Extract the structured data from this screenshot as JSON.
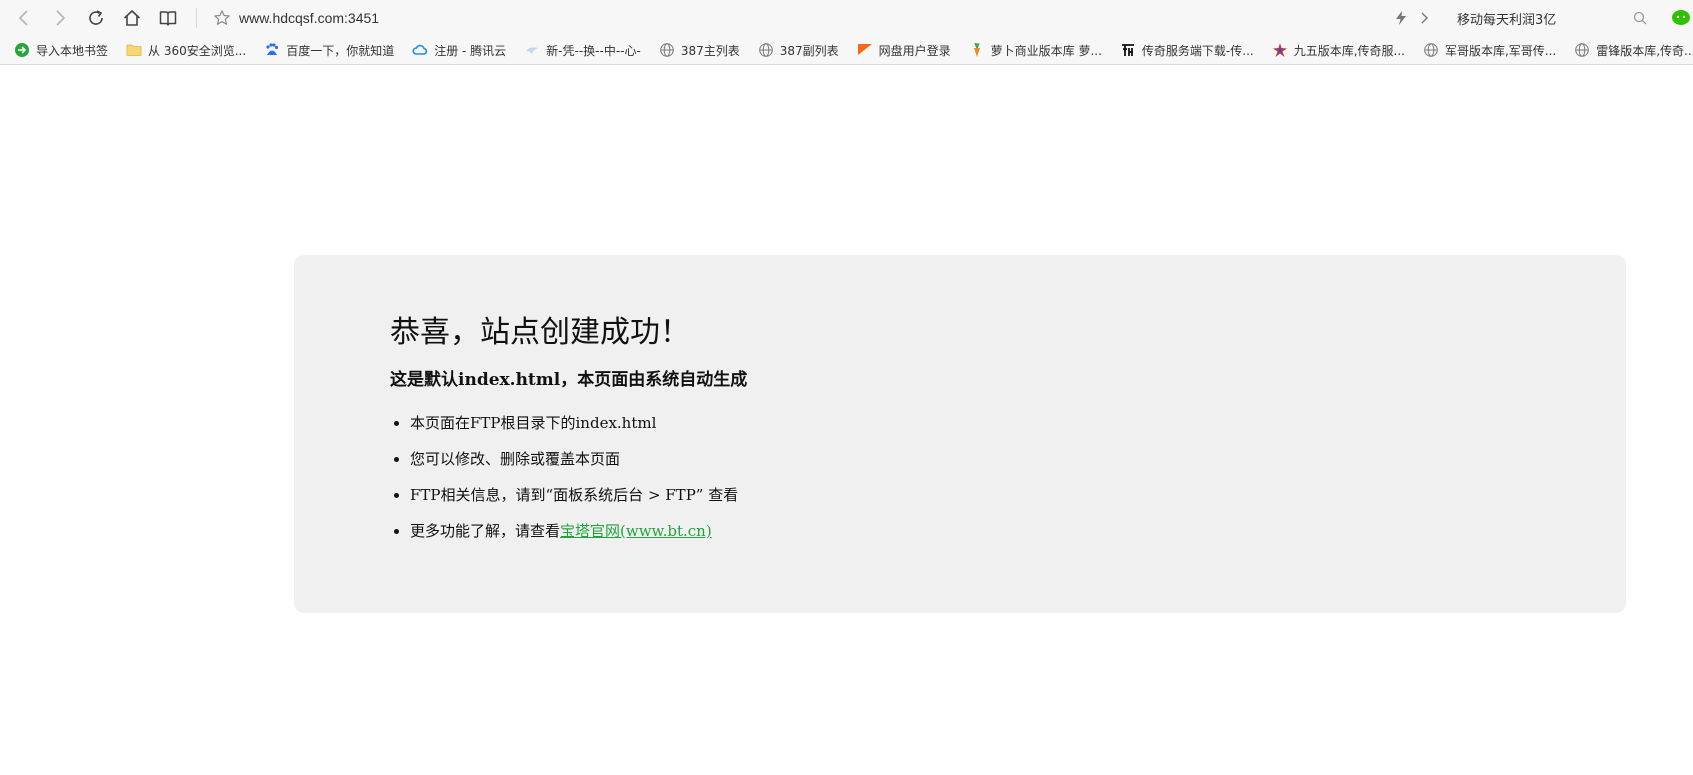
{
  "browser": {
    "url": "www.hdcqsf.com:3451",
    "search_text": "移动每天利润3亿",
    "bookmarks": [
      {
        "label": "导入本地书签",
        "icon": "import-icon"
      },
      {
        "label": "从 360安全浏览...",
        "icon": "folder-icon"
      },
      {
        "label": "百度一下，你就知道",
        "icon": "baidu-icon"
      },
      {
        "label": "注册 - 腾讯云",
        "icon": "tencent-cloud-icon"
      },
      {
        "label": "新-凭--换--中--心-",
        "icon": "site-icon"
      },
      {
        "label": "387主列表",
        "icon": "globe-icon"
      },
      {
        "label": "387副列表",
        "icon": "globe-icon"
      },
      {
        "label": "网盘用户登录",
        "icon": "pan-icon"
      },
      {
        "label": "萝卜商业版本库 萝...",
        "icon": "carrot-icon"
      },
      {
        "label": "传奇服务端下载-传...",
        "icon": "legend-icon"
      },
      {
        "label": "九五版本库,传奇服...",
        "icon": "star-logo-icon"
      },
      {
        "label": "军哥版本库,军哥传...",
        "icon": "globe-icon"
      },
      {
        "label": "雷锋版本库,传奇...",
        "icon": "globe-icon"
      }
    ],
    "colors": {
      "chrome_bg": "#f7f7f7",
      "link_green": "#20a53a",
      "wechat_green": "#2dc100"
    }
  },
  "page": {
    "title": "恭喜，站点创建成功！",
    "subtitle": "这是默认index.html，本页面由系统自动生成",
    "items": [
      {
        "text": "本页面在FTP根目录下的index.html"
      },
      {
        "text": "您可以修改、删除或覆盖本页面"
      },
      {
        "text": "FTP相关信息，请到“面板系统后台 > FTP” 查看"
      },
      {
        "text": "更多功能了解，请查看",
        "link": "宝塔官网(www.bt.cn)"
      }
    ]
  }
}
